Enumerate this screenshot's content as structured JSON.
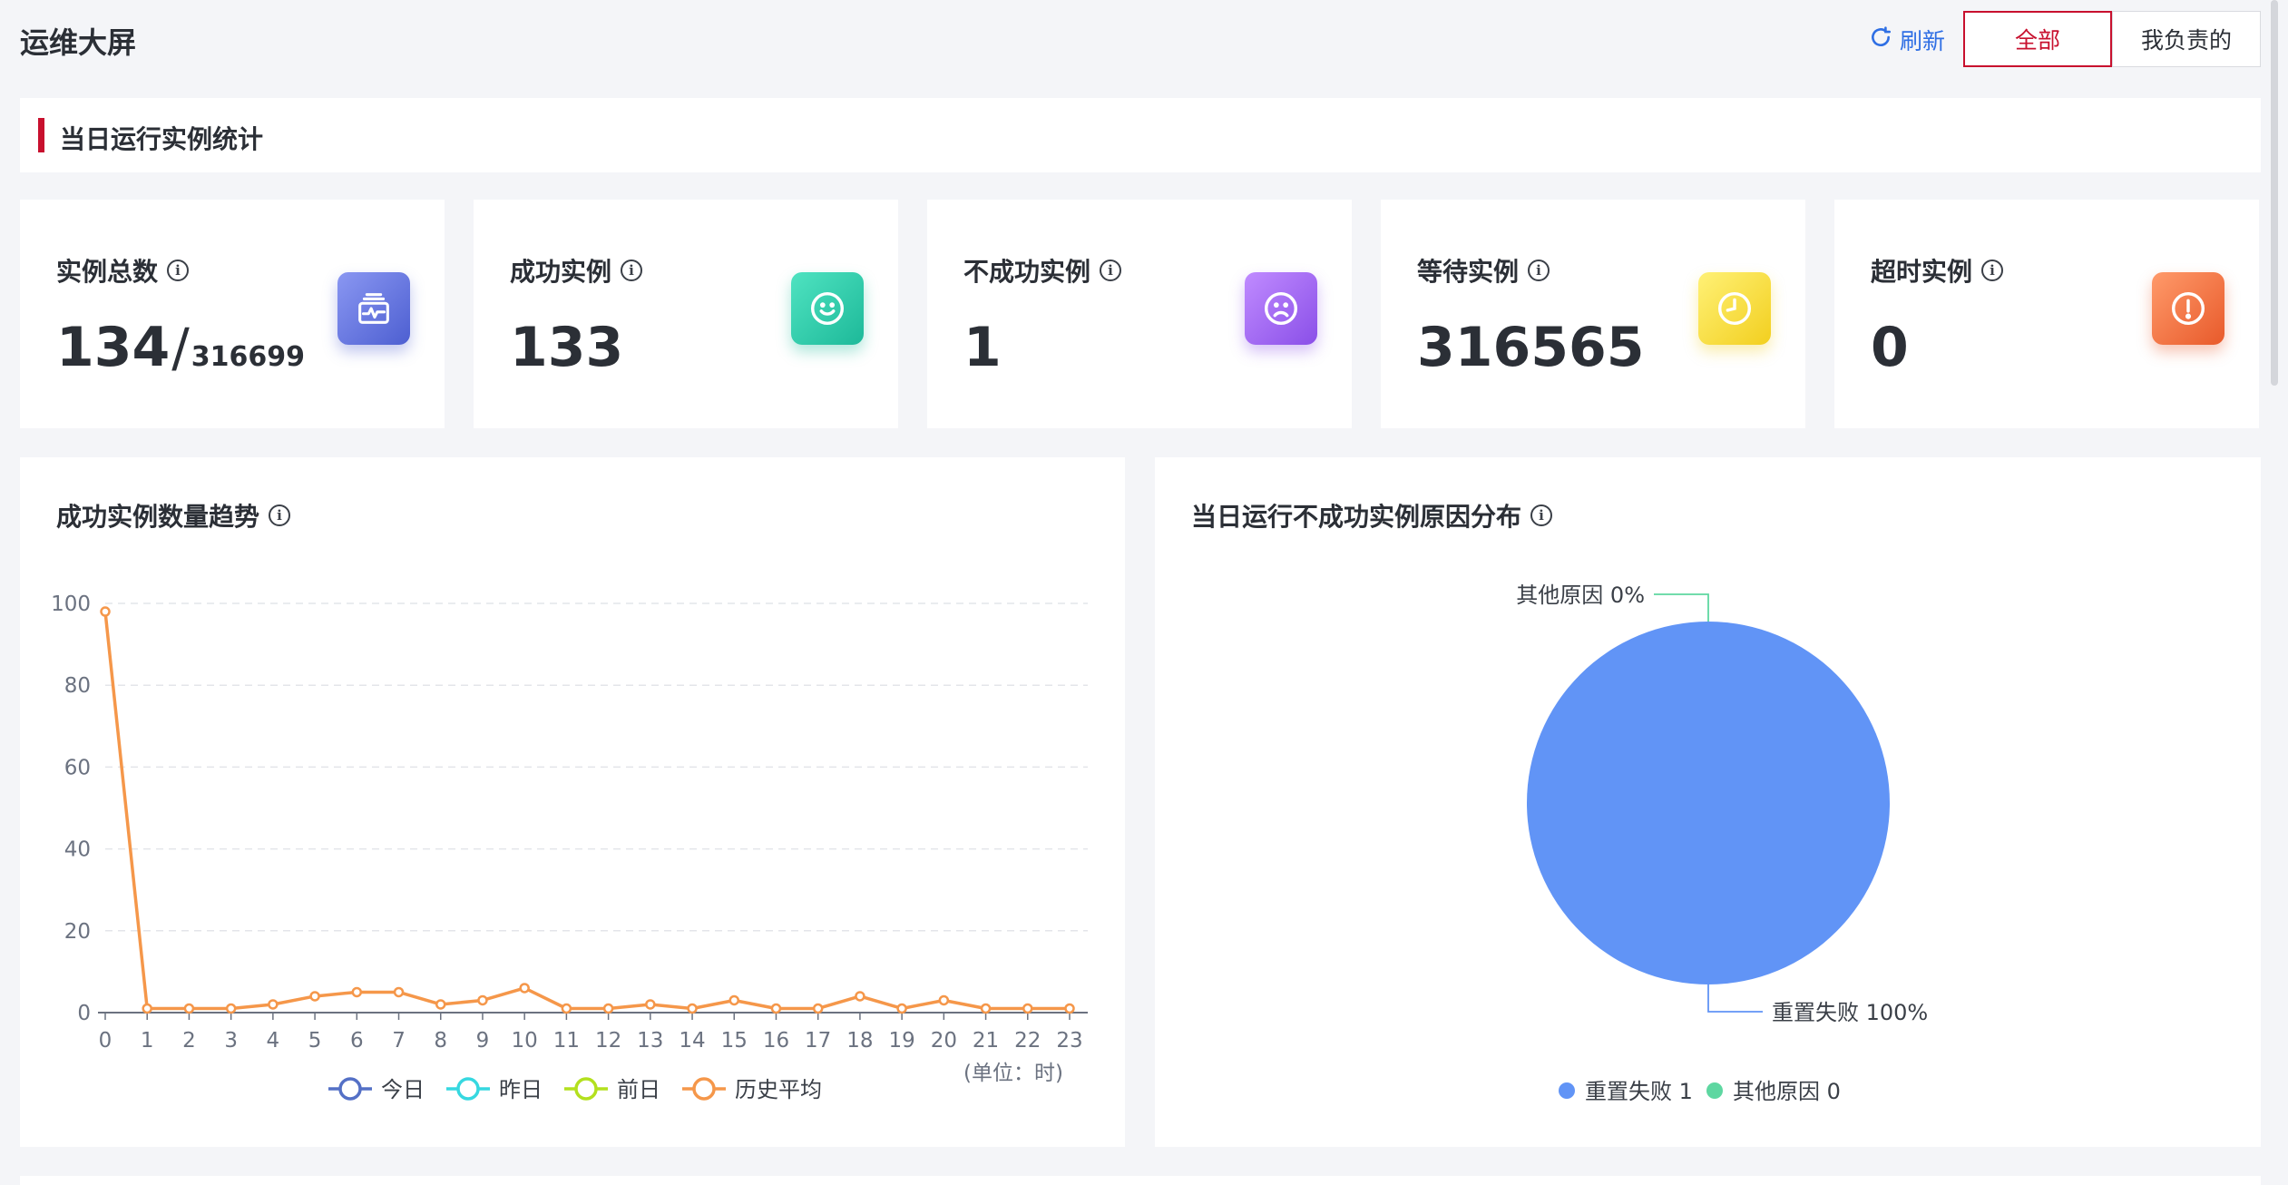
{
  "header": {
    "title": "运维大屏",
    "refresh_label": "刷新",
    "filter_all": "全部",
    "filter_mine": "我负责的"
  },
  "section": {
    "title": "当日运行实例统计"
  },
  "cards": [
    {
      "label": "实例总数",
      "value": "134",
      "slash": "/",
      "total": "316699",
      "icon": "monitor-icon",
      "color_from": "#8a97f2",
      "color_to": "#4d5fd1"
    },
    {
      "label": "成功实例",
      "value": "133",
      "icon": "smile-icon",
      "color_from": "#4fe3c1",
      "color_to": "#1db999"
    },
    {
      "label": "不成功实例",
      "value": "1",
      "icon": "frown-icon",
      "color_from": "#c08bff",
      "color_to": "#8a4fe8"
    },
    {
      "label": "等待实例",
      "value": "316565",
      "icon": "clock-icon",
      "color_from": "#fff176",
      "color_to": "#f2cf1f"
    },
    {
      "label": "超时实例",
      "value": "0",
      "icon": "alert-icon",
      "color_from": "#ff9a6a",
      "color_to": "#e85a2b"
    }
  ],
  "info_glyph": "i",
  "trend_panel": {
    "title": "成功实例数量趋势",
    "unit_label": "(单位：时)"
  },
  "pie_panel": {
    "title": "当日运行不成功实例原因分布"
  },
  "chart_data": [
    {
      "type": "line",
      "x": [
        "0",
        "1",
        "2",
        "3",
        "4",
        "5",
        "6",
        "7",
        "8",
        "9",
        "10",
        "11",
        "12",
        "13",
        "14",
        "15",
        "16",
        "17",
        "18",
        "19",
        "20",
        "21",
        "22",
        "23"
      ],
      "ylim": [
        0,
        100
      ],
      "yticks": [
        "0",
        "20",
        "40",
        "60",
        "80",
        "100"
      ],
      "grid": true,
      "legend_placement": "bottom",
      "series": [
        {
          "name": "今日",
          "color": "#5470c6",
          "values": []
        },
        {
          "name": "昨日",
          "color": "#36d8e0",
          "values": []
        },
        {
          "name": "前日",
          "color": "#b3e01e",
          "values": []
        },
        {
          "name": "历史平均",
          "color": "#f5974a",
          "values": [
            98,
            1,
            1,
            1,
            2,
            4,
            5,
            5,
            2,
            3,
            6,
            1,
            1,
            2,
            1,
            3,
            1,
            1,
            4,
            1,
            3,
            1,
            1,
            1
          ]
        }
      ]
    },
    {
      "type": "pie",
      "legend_placement": "bottom",
      "slices": [
        {
          "name": "重置失败",
          "value": 1,
          "percent": "100%",
          "color": "#6194f6",
          "label": "重置失败 100%",
          "legend": "重置失败 1"
        },
        {
          "name": "其他原因",
          "value": 0,
          "percent": "0%",
          "color": "#5ed7a1",
          "label": "其他原因 0%",
          "legend": "其他原因 0"
        }
      ]
    }
  ]
}
